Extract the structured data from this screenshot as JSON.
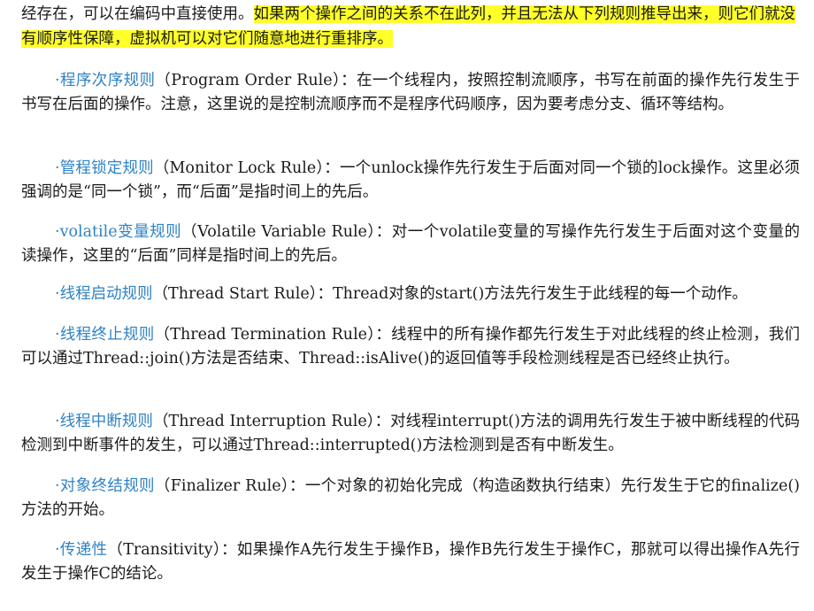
{
  "intro": {
    "plain": "经存在，可以在编码中直接使用。",
    "highlight": "如果两个操作之间的关系不在此列，并且无法从下列规则推导出来，则它们就没有顺序性保障，虚拟机可以对它们随意地进行重排序。"
  },
  "rules": [
    {
      "name": "·程序次序规则",
      "text": "（Program Order Rule）：在一个线程内，按照控制流顺序，书写在前面的操作先行发生于书写在后面的操作。注意，这里说的是控制流顺序而不是程序代码顺序，因为要考虑分支、循环等结构。"
    },
    {
      "name": "·管程锁定规则",
      "text": "（Monitor Lock Rule）：一个unlock操作先行发生于后面对同一个锁的lock操作。这里必须强调的是“同一个锁”，而“后面”是指时间上的先后。"
    },
    {
      "name": "·volatile变量规则",
      "text": "（Volatile Variable Rule）：对一个volatile变量的写操作先行发生于后面对这个变量的读操作，这里的“后面”同样是指时间上的先后。"
    },
    {
      "name": "·线程启动规则",
      "text": "（Thread Start Rule）：Thread对象的start()方法先行发生于此线程的每一个动作。"
    },
    {
      "name": "·线程终止规则",
      "text": "（Thread Termination Rule）：线程中的所有操作都先行发生于对此线程的终止检测，我们可以通过Thread::join()方法是否结束、Thread::isAlive()的返回值等手段检测线程是否已经终止执行。"
    },
    {
      "name": "·线程中断规则",
      "text": "（Thread Interruption Rule）：对线程interrupt()方法的调用先行发生于被中断线程的代码检测到中断事件的发生，可以通过Thread::interrupted()方法检测到是否有中断发生。"
    },
    {
      "name": "·对象终结规则",
      "text": "（Finalizer Rule）：一个对象的初始化完成（构造函数执行结束）先行发生于它的finalize()方法的开始。"
    },
    {
      "name": "·传递性",
      "text": "（Transitivity）：如果操作A先行发生于操作B，操作B先行发生于操作C，那就可以得出操作A先行发生于操作C的结论。"
    }
  ],
  "colors": {
    "highlight": "#ffff29",
    "rule_name": "#2f82c4",
    "text": "#1a1a1a"
  }
}
